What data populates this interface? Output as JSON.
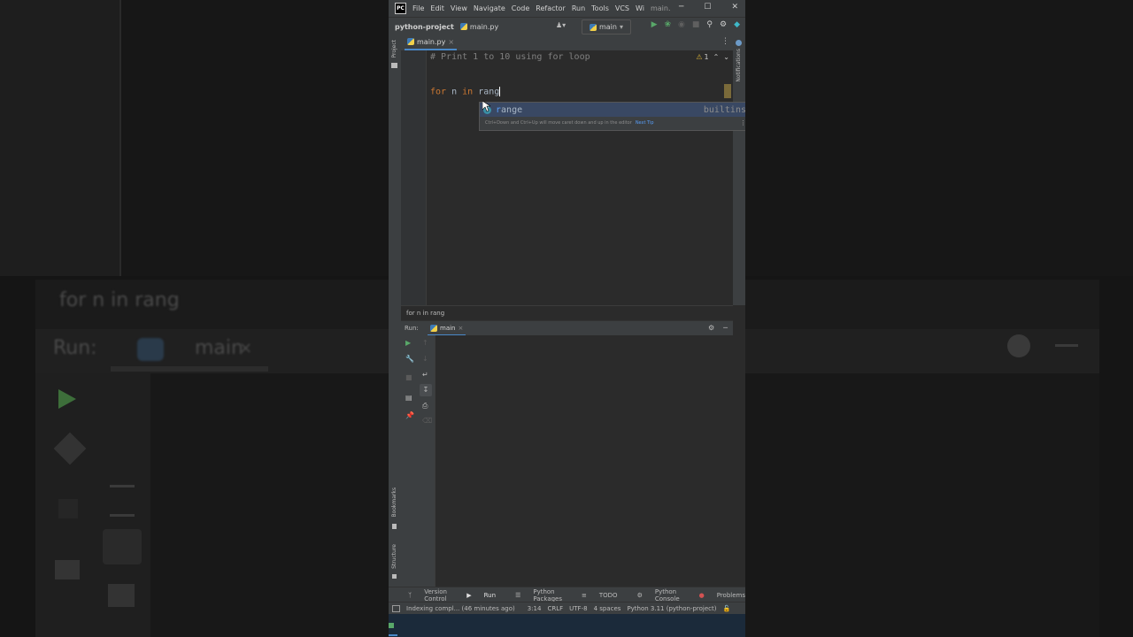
{
  "background": {
    "blurred_code": "for n in rang",
    "blurred_run_label": "Run:",
    "blurred_tab_label": "main",
    "blurred_close": "×"
  },
  "titlebar": {
    "logo": "PC",
    "menu": [
      "File",
      "Edit",
      "View",
      "Navigate",
      "Code",
      "Refactor",
      "Run",
      "Tools",
      "VCS",
      "Wi",
      "main."
    ],
    "minimize": "─",
    "maximize": "☐",
    "close": "✕"
  },
  "navbar": {
    "project": "python-project",
    "file": "main.py",
    "run_config": "main"
  },
  "left_strip": {
    "project": "Project",
    "bookmarks": "Bookmarks",
    "structure": "Structure"
  },
  "right_strip": {
    "notifications": "Notifications"
  },
  "editor": {
    "tab_label": "main.py",
    "tab_close": "×",
    "warning_count": "1",
    "line1": "# Print 1 to 10 using for loop",
    "line3_kw1": "for",
    "line3_var": " n ",
    "line3_kw2": "in",
    "line3_rest": " rang"
  },
  "completion": {
    "icon": "f",
    "match": "r",
    "rest": "ange",
    "source": "builtins",
    "hint": "Ctrl+Down and Ctrl+Up will move caret down and up in the editor",
    "next_tip": "Next Tip",
    "more": "⋮"
  },
  "editor_breadcrumb": "for n in rang",
  "run_panel": {
    "label": "Run:",
    "tab": "main",
    "tab_close": "×",
    "settings": "⚙",
    "hide": "─"
  },
  "tool_windows": [
    "Version Control",
    "Run",
    "Python Packages",
    "TODO",
    "Python Console",
    "Problems"
  ],
  "status": {
    "indexing": "Indexing compl... (46 minutes ago)",
    "position": "3:14",
    "line_sep": "CRLF",
    "encoding": "UTF-8",
    "indent": "4 spaces",
    "interpreter": "Python 3.11 (python-project)"
  },
  "colors": {
    "accent": "#4a88c7",
    "keyword": "#cc7832",
    "comment": "#808080",
    "text": "#a9b7c6"
  }
}
